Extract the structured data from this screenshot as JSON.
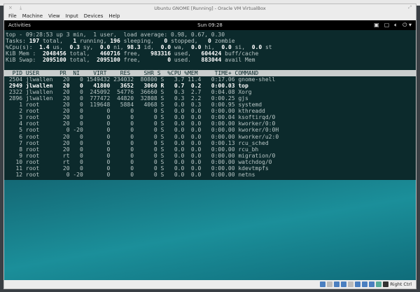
{
  "window": {
    "title": "Ubuntu GNOME [Running] - Oracle VM VirtualBox"
  },
  "menu": [
    "File",
    "Machine",
    "View",
    "Input",
    "Devices",
    "Help"
  ],
  "gnome": {
    "activities": "Activities",
    "clock": "Sun 09:28"
  },
  "top": {
    "line1": "top - 09:28:53 up 3 min,  1 user,  load average: 0.98, 0.67, 0.30",
    "tasks": {
      "total": "197",
      "running": "1",
      "sleeping": "196",
      "stopped": "0",
      "zombie": "0"
    },
    "cpu": {
      "us": "1.4",
      "sy": "0.3",
      "ni": "0.0",
      "id": "98.3",
      "wa": "0.0",
      "hi": "0.0",
      "si": "0.0",
      "st": "0.0"
    },
    "mem": {
      "total": "2048456",
      "free": "460716",
      "used": "983316",
      "buff_cache": "604424"
    },
    "swap": {
      "total": "2095100",
      "free": "2095100",
      "used": "0",
      "avail": "883044"
    },
    "header": "  PID USER      PR  NI    VIRT    RES    SHR S  %CPU %MEM     TIME+ COMMAND",
    "processes": [
      [
        "2504",
        "jlwallen",
        "20",
        "0",
        "1549432",
        "234032",
        "80800",
        "S",
        "3.7",
        "11.4",
        "0:17.06",
        "gnome-shell"
      ],
      [
        "2949",
        "jlwallen",
        "20",
        "0",
        "41800",
        "3652",
        "3060",
        "R",
        "0.7",
        "0.2",
        "0:00.03",
        "top"
      ],
      [
        "2322",
        "jlwallen",
        "20",
        "0",
        "245092",
        "54776",
        "36660",
        "S",
        "0.3",
        "2.7",
        "0:04.08",
        "Xorg"
      ],
      [
        "2896",
        "jlwallen",
        "20",
        "0",
        "777472",
        "44820",
        "32808",
        "S",
        "0.3",
        "2.2",
        "0:00.25",
        "gjs"
      ],
      [
        "1",
        "root",
        "20",
        "0",
        "119648",
        "5884",
        "4068",
        "S",
        "0.0",
        "0.3",
        "0:00.95",
        "systemd"
      ],
      [
        "2",
        "root",
        "20",
        "0",
        "0",
        "0",
        "0",
        "S",
        "0.0",
        "0.0",
        "0:00.00",
        "kthreadd"
      ],
      [
        "3",
        "root",
        "20",
        "0",
        "0",
        "0",
        "0",
        "S",
        "0.0",
        "0.0",
        "0:00.04",
        "ksoftirqd/0"
      ],
      [
        "4",
        "root",
        "20",
        "0",
        "0",
        "0",
        "0",
        "S",
        "0.0",
        "0.0",
        "0:00.00",
        "kworker/0:0"
      ],
      [
        "5",
        "root",
        "0",
        "-20",
        "0",
        "0",
        "0",
        "S",
        "0.0",
        "0.0",
        "0:00.00",
        "kworker/0:0H"
      ],
      [
        "6",
        "root",
        "20",
        "0",
        "0",
        "0",
        "0",
        "S",
        "0.0",
        "0.0",
        "0:00.00",
        "kworker/u2:0"
      ],
      [
        "7",
        "root",
        "20",
        "0",
        "0",
        "0",
        "0",
        "S",
        "0.0",
        "0.0",
        "0:00.13",
        "rcu_sched"
      ],
      [
        "8",
        "root",
        "20",
        "0",
        "0",
        "0",
        "0",
        "S",
        "0.0",
        "0.0",
        "0:00.00",
        "rcu_bh"
      ],
      [
        "9",
        "root",
        "rt",
        "0",
        "0",
        "0",
        "0",
        "S",
        "0.0",
        "0.0",
        "0:00.00",
        "migration/0"
      ],
      [
        "10",
        "root",
        "rt",
        "0",
        "0",
        "0",
        "0",
        "S",
        "0.0",
        "0.0",
        "0:00.00",
        "watchdog/0"
      ],
      [
        "11",
        "root",
        "20",
        "0",
        "0",
        "0",
        "0",
        "S",
        "0.0",
        "0.0",
        "0:00.00",
        "kdevtmpfs"
      ],
      [
        "12",
        "root",
        "0",
        "-20",
        "0",
        "0",
        "0",
        "S",
        "0.0",
        "0.0",
        "0:00.00",
        "netns"
      ]
    ]
  },
  "statusbar": {
    "host_key": "Right Ctrl"
  }
}
